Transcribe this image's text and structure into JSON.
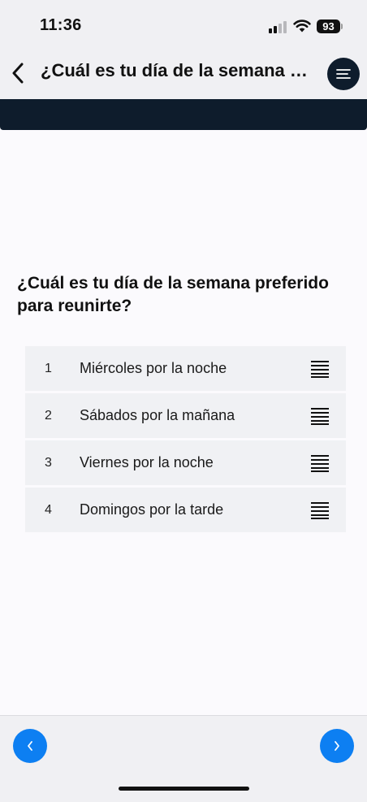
{
  "status_bar": {
    "time": "11:36",
    "battery": "93",
    "icons": [
      "signal-icon",
      "wifi-icon",
      "battery-icon"
    ]
  },
  "nav": {
    "back_icon": "chevron-left-icon",
    "title": "¿Cuál es tu día de la semana preferido para reunirte?",
    "menu_icon": "menu-icon"
  },
  "question": "¿Cuál es tu día de la semana preferido para reunirte?",
  "options": [
    {
      "rank": "1",
      "label": "Miércoles por la noche"
    },
    {
      "rank": "2",
      "label": "Sábados por la mañana"
    },
    {
      "rank": "3",
      "label": "Viernes por la noche"
    },
    {
      "rank": "4",
      "label": "Domingos por la tarde"
    }
  ],
  "footer": {
    "prev_icon": "chevron-left-icon",
    "next_icon": "chevron-right-icon"
  },
  "colors": {
    "accent": "#0d7ff2",
    "header_dark": "#0e1c2c",
    "background": "#f0f0f3",
    "content_background": "#fbfafd",
    "option_background": "#f0f1f4"
  }
}
